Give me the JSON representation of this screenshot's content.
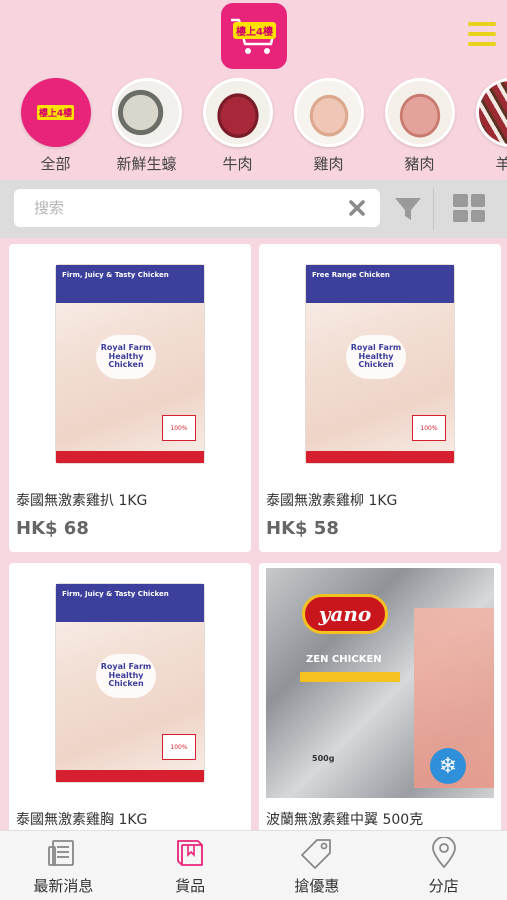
{
  "header": {
    "logo_text": "樓上4樓",
    "menu_icon": "hamburger-menu-icon"
  },
  "categories": [
    {
      "label": "全部",
      "thumb": "all",
      "active": true
    },
    {
      "label": "新鮮生蠔",
      "thumb": "oyster",
      "active": false
    },
    {
      "label": "牛肉",
      "thumb": "beef",
      "active": false
    },
    {
      "label": "雞肉",
      "thumb": "chicken",
      "active": false
    },
    {
      "label": "豬肉",
      "thumb": "pork",
      "active": false
    },
    {
      "label": "羊肉",
      "thumb": "lamb",
      "active": false
    }
  ],
  "search": {
    "placeholder": "搜索",
    "value": ""
  },
  "products": [
    {
      "name": "泰國無激素雞扒 1KG",
      "price": "HK$ 68",
      "bag_title": "Firm, Juicy & Tasty Chicken",
      "brand": "Royal Farm Healthy Chicken"
    },
    {
      "name": "泰國無激素雞柳 1KG",
      "price": "HK$ 58",
      "bag_title": "Free Range Chicken",
      "brand": "Royal Farm Healthy Chicken"
    },
    {
      "name": "泰國無激素雞胸 1KG",
      "price": "",
      "bag_title": "Firm, Juicy & Tasty Chicken",
      "brand": "Royal Farm Healthy Chicken"
    },
    {
      "name": "波蘭無激素雞中翼 500克",
      "price": "",
      "bag_title": "yano",
      "brand": "ZEN CHICKEN"
    }
  ],
  "bottom_nav": [
    {
      "label": "最新消息",
      "icon": "news-icon"
    },
    {
      "label": "貨品",
      "icon": "book-icon",
      "active": true
    },
    {
      "label": "搶優惠",
      "icon": "tag-icon"
    },
    {
      "label": "分店",
      "icon": "location-pin-icon"
    }
  ],
  "colors": {
    "accent": "#e8247a",
    "header_bg": "#f8d5de",
    "menu_icon": "#e8d21a"
  }
}
